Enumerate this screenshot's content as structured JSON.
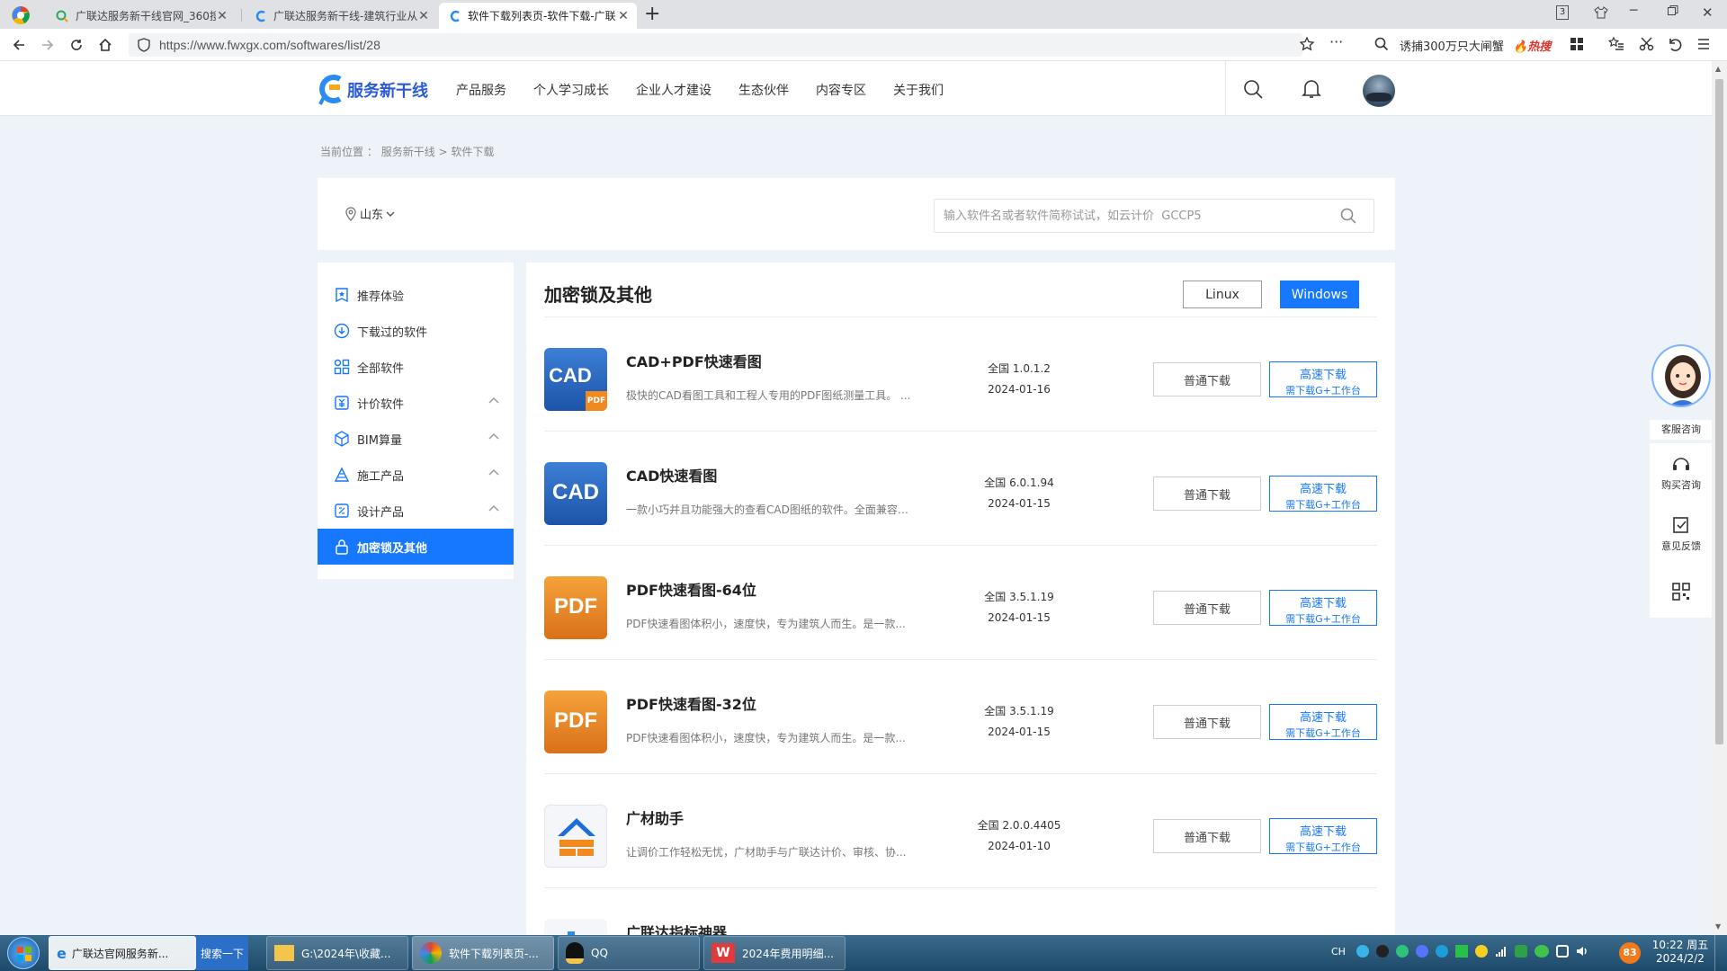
{
  "browser": {
    "tabs": [
      {
        "title": "广联达服务新干线官网_360搜…"
      },
      {
        "title": "广联达服务新干线-建筑行业从…"
      },
      {
        "title": "软件下载列表页-软件下载-广联…"
      }
    ],
    "new_tab_symbol": "+",
    "tab_count_badge": "3",
    "url": "https://www.fwxgx.com/softwares/list/28",
    "hot_search": "诱捕300万只大闸蟹",
    "hot_tag": "热搜"
  },
  "site": {
    "logo_text": "服务新干线",
    "nav": [
      "产品服务",
      "个人学习成长",
      "企业人才建设",
      "生态伙伴",
      "内容专区",
      "关于我们"
    ]
  },
  "breadcrumb": {
    "prefix": "当前位置",
    "colon": "：",
    "items": [
      "服务新干线",
      "软件下载"
    ],
    "separator": ">"
  },
  "search": {
    "region": "山东",
    "placeholder": "输入软件名或者软件简称试试，如云计价  GCCP5"
  },
  "sidebar": {
    "items": [
      {
        "label": "推荐体验",
        "icon": "recommend-icon",
        "expandable": false
      },
      {
        "label": "下载过的软件",
        "icon": "cloud-download-icon",
        "expandable": false
      },
      {
        "label": "全部软件",
        "icon": "grid-apps-icon",
        "expandable": false
      },
      {
        "label": "计价软件",
        "icon": "pricing-icon",
        "expandable": true
      },
      {
        "label": "BIM算量",
        "icon": "cube-icon",
        "expandable": true
      },
      {
        "label": "施工产品",
        "icon": "construction-icon",
        "expandable": true
      },
      {
        "label": "设计产品",
        "icon": "design-icon",
        "expandable": true
      },
      {
        "label": "加密锁及其他",
        "icon": "lock-icon",
        "expandable": false,
        "active": true
      }
    ]
  },
  "main": {
    "title": "加密锁及其他",
    "os_options": [
      "Linux",
      "Windows"
    ],
    "selected_os": "Windows",
    "normal_download_label": "普通下载",
    "fast_download_label": "高速下载",
    "fast_download_sub": "需下载G+工作台",
    "software": [
      {
        "name": "CAD+PDF快速看图",
        "desc": "极快的CAD看图工具和工程人专用的PDF图纸测量工具。 ...",
        "version": "全国  1.0.1.2",
        "date": "2024-01-16",
        "icon": "cad-pdf-viewer-icon",
        "icon_text": "CAD",
        "icon_badge": "PDF"
      },
      {
        "name": "CAD快速看图",
        "desc": "一款小巧并且功能强大的查看CAD图纸的软件。全面兼容A...",
        "version": "全国  6.0.1.94",
        "date": "2024-01-15",
        "icon": "cad-viewer-icon",
        "icon_text": "CAD"
      },
      {
        "name": "PDF快速看图-64位",
        "desc": "PDF快速看图体积小，速度快，专为建筑人而生。是一款...",
        "version": "全国  3.5.1.19",
        "date": "2024-01-15",
        "icon": "pdf-viewer-icon",
        "icon_text": "PDF"
      },
      {
        "name": "PDF快速看图-32位",
        "desc": "PDF快速看图体积小，速度快，专为建筑人而生。是一款...",
        "version": "全国  3.5.1.19",
        "date": "2024-01-15",
        "icon": "pdf-viewer-icon",
        "icon_text": "PDF"
      },
      {
        "name": "广材助手",
        "desc": "让调价工作轻松无忧，广材助手与广联达计价、审核、协...",
        "version": "全国  2.0.0.4405",
        "date": "2024-01-10",
        "icon": "material-assistant-icon"
      },
      {
        "name": "广联达指标神器",
        "desc": "",
        "version": "",
        "date": "",
        "icon": "index-tool-icon"
      }
    ]
  },
  "float_panel": {
    "service_label": "客服咨询",
    "purchase_label": "购买咨询",
    "feedback_label": "意见反馈"
  },
  "taskbar": {
    "items": [
      {
        "label": "广联达官网服务新..."
      },
      {
        "label": "搜索一下"
      },
      {
        "label": "G:\\2024年\\收藏..."
      },
      {
        "label": "软件下载列表页-..."
      },
      {
        "label": "QQ"
      },
      {
        "label": "2024年费用明细..."
      }
    ],
    "tray_badge": "83",
    "ime": "CH",
    "time": "10:22 周五",
    "date": "2024/2/2"
  },
  "colors": {
    "accent": "#1677ff",
    "page_bg": "#eef3fa",
    "hot": "#e0332c"
  }
}
